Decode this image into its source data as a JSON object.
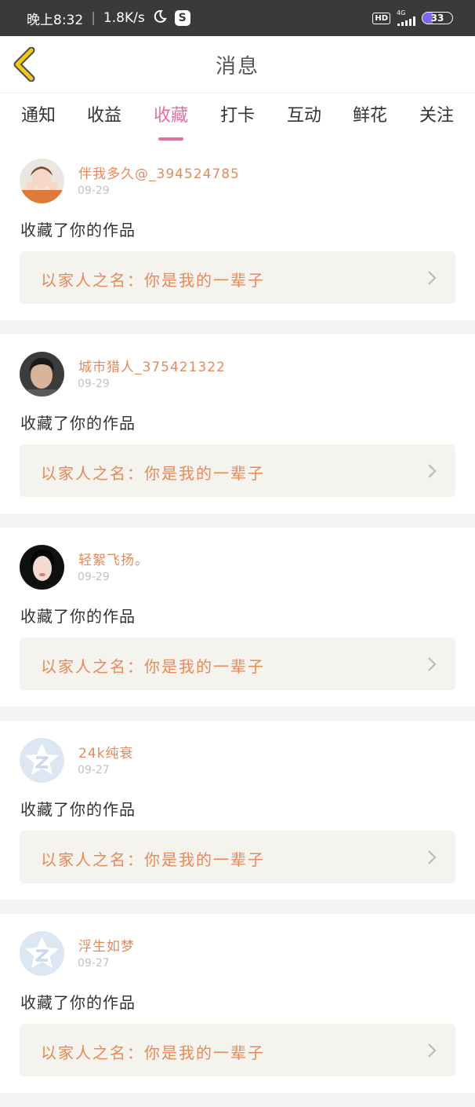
{
  "status_bar": {
    "time": "晚上8:32",
    "speed": "1.8K/s",
    "hd": "HD",
    "network": "4G",
    "battery": "33"
  },
  "header": {
    "title": "消息",
    "back_icon": "chevron-left-icon"
  },
  "tabs": [
    {
      "label": "通知",
      "active": false
    },
    {
      "label": "收益",
      "active": false
    },
    {
      "label": "收藏",
      "active": true
    },
    {
      "label": "打卡",
      "active": false
    },
    {
      "label": "互动",
      "active": false
    },
    {
      "label": "鲜花",
      "active": false
    },
    {
      "label": "关注",
      "active": false
    }
  ],
  "messages": [
    {
      "username": "伴我多久@_394524785",
      "date": "09-29",
      "action": "收藏了你的作品",
      "work_title": "以家人之名：你是我的一辈子",
      "avatar": "photo-girl-avatar"
    },
    {
      "username": "城市猎人_375421322",
      "date": "09-29",
      "action": "收藏了你的作品",
      "work_title": "以家人之名：你是我的一辈子",
      "avatar": "photo-boy-avatar"
    },
    {
      "username": "轻絮飞扬。",
      "date": "09-29",
      "action": "收藏了你的作品",
      "work_title": "以家人之名：你是我的一辈子",
      "avatar": "photo-woman-avatar"
    },
    {
      "username": "24k纯衰",
      "date": "09-27",
      "action": "收藏了你的作品",
      "work_title": "以家人之名：你是我的一辈子",
      "avatar": "default-star-avatar"
    },
    {
      "username": "浮生如梦",
      "date": "09-27",
      "action": "收藏了你的作品",
      "work_title": "以家人之名：你是我的一辈子",
      "avatar": "default-star-avatar"
    }
  ],
  "colors": {
    "accent": "#e46fa0",
    "username": "#e68a5c",
    "card_link_bg": "#f4f3ed",
    "back_icon": "#f2c81a"
  }
}
